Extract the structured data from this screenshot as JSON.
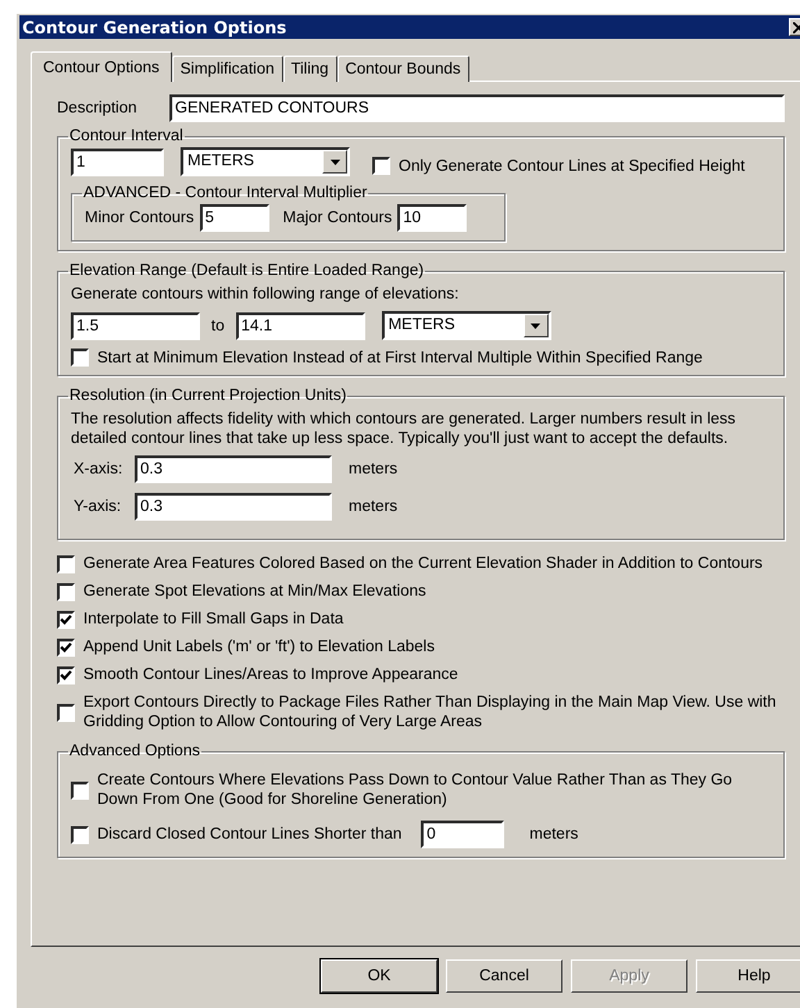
{
  "window": {
    "title": "Contour Generation Options"
  },
  "tabs": [
    {
      "label": "Contour Options",
      "selected": true
    },
    {
      "label": "Simplification",
      "selected": false
    },
    {
      "label": "Tiling",
      "selected": false
    },
    {
      "label": "Contour Bounds",
      "selected": false
    }
  ],
  "description": {
    "label": "Description",
    "value": "GENERATED CONTOURS"
  },
  "contour_interval": {
    "legend": "Contour Interval",
    "value": "1",
    "units": "METERS",
    "checkbox": {
      "label": "Only Generate Contour Lines at Specified Height",
      "checked": false
    },
    "advanced": {
      "legend": "ADVANCED - Contour Interval Multiplier",
      "minor_label": "Minor Contours",
      "minor_value": "5",
      "major_label": "Major Contours",
      "major_value": "10"
    }
  },
  "elevation_range": {
    "legend": "Elevation Range (Default is Entire Loaded Range)",
    "prompt": "Generate contours within following range of elevations:",
    "from": "1.5",
    "to_label": "to",
    "to": "14.1",
    "units": "METERS",
    "checkbox": {
      "label": "Start at Minimum Elevation Instead of at First Interval Multiple Within Specified Range",
      "checked": false
    }
  },
  "resolution": {
    "legend": "Resolution (in Current Projection Units)",
    "text": "The resolution affects fidelity with which contours are generated. Larger numbers result in less detailed contour lines that take up less space. Typically you'll just want to accept the defaults.",
    "axes": [
      {
        "label": "X-axis:",
        "value": "0.3",
        "unit": "meters"
      },
      {
        "label": "Y-axis:",
        "value": "0.3",
        "unit": "meters"
      }
    ]
  },
  "options": [
    {
      "label": "Generate Area Features Colored Based on the Current Elevation Shader in Addition to Contours",
      "checked": false
    },
    {
      "label": "Generate Spot Elevations at Min/Max Elevations",
      "checked": false
    },
    {
      "label": "Interpolate to Fill Small Gaps in Data",
      "checked": true
    },
    {
      "label": "Append Unit Labels ('m' or 'ft') to Elevation Labels",
      "checked": true
    },
    {
      "label": "Smooth Contour Lines/Areas to Improve Appearance",
      "checked": true
    },
    {
      "label": "Export Contours Directly to Package Files Rather Than Displaying in the Main Map View. Use with Gridding Option to Allow Contouring of Very Large Areas",
      "checked": false
    }
  ],
  "advanced_options": {
    "legend": "Advanced Options",
    "create": {
      "label": "Create Contours Where Elevations Pass Down to Contour Value Rather Than as They Go Down From One (Good for Shoreline Generation)",
      "checked": false
    },
    "discard": {
      "label": "Discard Closed Contour Lines Shorter than",
      "checked": false,
      "value": "0",
      "unit": "meters"
    }
  },
  "buttons": [
    {
      "label": "OK",
      "disabled": false,
      "default": true
    },
    {
      "label": "Cancel",
      "disabled": false,
      "default": false
    },
    {
      "label": "Apply",
      "disabled": true,
      "default": false
    },
    {
      "label": "Help",
      "disabled": false,
      "default": false
    }
  ]
}
